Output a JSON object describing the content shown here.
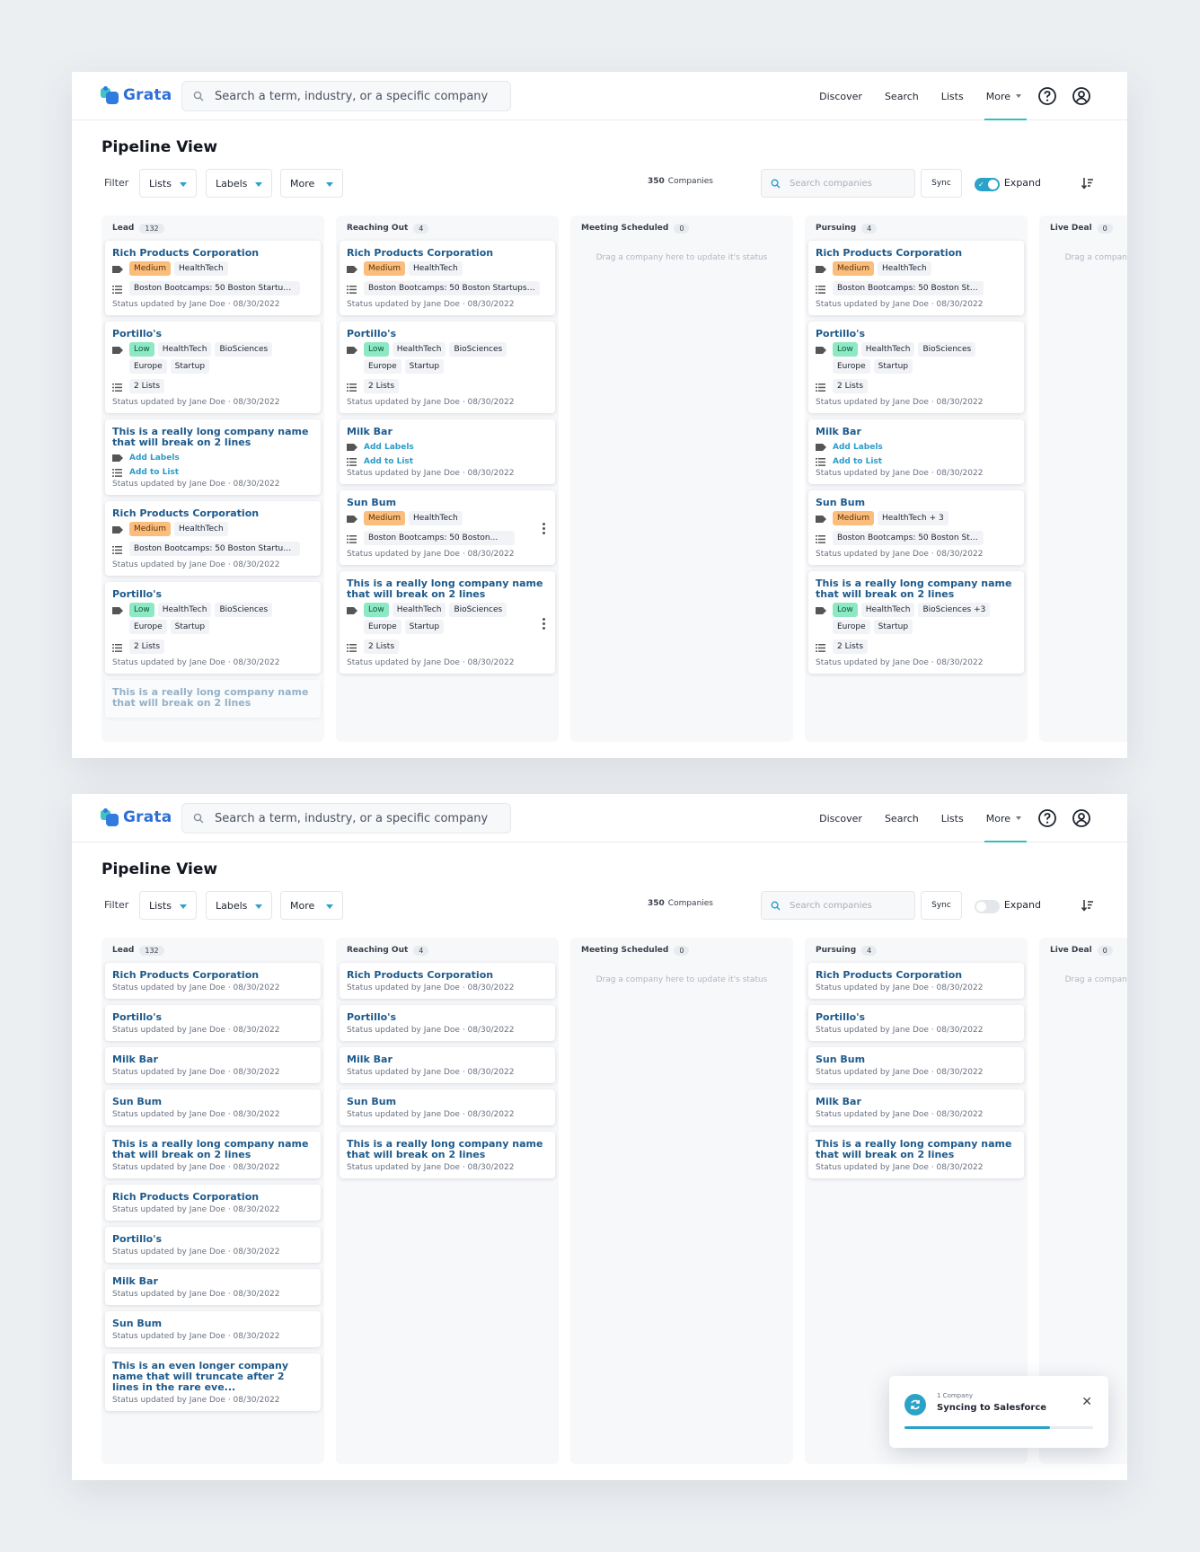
{
  "brand": {
    "name": "Grata"
  },
  "search": {
    "placeholder": "Search a term, industry, or a specific company"
  },
  "nav": {
    "discover": "Discover",
    "search": "Search",
    "lists": "Lists",
    "more": "More"
  },
  "page": {
    "title": "Pipeline View"
  },
  "filters": {
    "label": "Filter",
    "lists": "Lists",
    "labels": "Labels",
    "more": "More"
  },
  "companies": {
    "count": "350",
    "label": "Companies"
  },
  "company_search": {
    "placeholder": "Search companies"
  },
  "sync": {
    "label": "Sync"
  },
  "expand": {
    "label": "Expand",
    "expanded_view": true,
    "compact_view": false
  },
  "empty_text": "Drag a company here to update it's status",
  "columns": [
    {
      "name": "Lead",
      "count": "132"
    },
    {
      "name": "Reaching Out",
      "count": "4"
    },
    {
      "name": "Meeting Scheduled",
      "count": "0"
    },
    {
      "name": "Pursuing",
      "count": "4"
    },
    {
      "name": "Live Deal",
      "count": "0"
    }
  ],
  "expanded_cards": {
    "lead": [
      {
        "name": "Rich Products Corporation",
        "labels": [
          "Medium",
          "HealthTech"
        ],
        "list": "Boston Bootcamps: 50 Boston Startups t...",
        "status": "Status updated by Jane Doe · 08/30/2022"
      },
      {
        "name": "Portillo's",
        "labels": [
          "Low",
          "HealthTech",
          "BioSciences",
          "Europe",
          "Startup"
        ],
        "list": "2 Lists",
        "status": "Status updated by Jane Doe · 08/30/2022"
      },
      {
        "name": "This is a really long company name that will break on 2 lines",
        "add_labels": "Add Labels",
        "add_list": "Add to List",
        "status": "Status updated by Jane Doe · 08/30/2022"
      },
      {
        "name": "Rich Products Corporation",
        "labels": [
          "Medium",
          "HealthTech"
        ],
        "list": "Boston Bootcamps: 50 Boston Startups t...",
        "status": "Status updated by Jane Doe · 08/30/2022"
      },
      {
        "name": "Portillo's",
        "labels": [
          "Low",
          "HealthTech",
          "BioSciences",
          "Europe",
          "Startup"
        ],
        "list": "2 Lists",
        "status": "Status updated by Jane Doe · 08/30/2022"
      },
      {
        "name": "This is a really long company name that will break on 2 lines"
      }
    ],
    "reaching_out": [
      {
        "name": "Rich Products Corporation",
        "labels": [
          "Medium",
          "HealthTech"
        ],
        "list": "Boston Bootcamps: 50 Boston Startups t...",
        "status": "Status updated by Jane Doe · 08/30/2022"
      },
      {
        "name": "Portillo's",
        "labels": [
          "Low",
          "HealthTech",
          "BioSciences",
          "Europe",
          "Startup"
        ],
        "list": "2 Lists",
        "status": "Status updated by Jane Doe · 08/30/2022"
      },
      {
        "name": "Milk Bar",
        "add_labels": "Add Labels",
        "add_list": "Add to List",
        "status": "Status updated by Jane Doe · 08/30/2022"
      },
      {
        "name": "Sun Bum",
        "labels": [
          "Medium",
          "HealthTech"
        ],
        "list": "Boston Bootcamps: 50 Boston...",
        "status": "Status updated by Jane Doe · 08/30/2022"
      },
      {
        "name": "This is a really long company name that will break on 2 lines",
        "labels": [
          "Low",
          "HealthTech",
          "BioSciences",
          "Europe",
          "Startup"
        ],
        "list": "2 Lists",
        "status": "Status updated by Jane Doe · 08/30/2022"
      }
    ],
    "pursuing": [
      {
        "name": "Rich Products Corporation",
        "labels": [
          "Medium",
          "HealthTech"
        ],
        "list": "Boston Bootcamps: 50 Boston Star....",
        "status": "Status updated by Jane Doe · 08/30/2022"
      },
      {
        "name": "Portillo's",
        "labels": [
          "Low",
          "HealthTech",
          "BioSciences",
          "Europe",
          "Startup"
        ],
        "list": "2 Lists",
        "status": "Status updated by Jane Doe · 08/30/2022"
      },
      {
        "name": "Milk Bar",
        "add_labels": "Add Labels",
        "add_list": "Add to List",
        "status": "Status updated by Jane Doe · 08/30/2022"
      },
      {
        "name": "Sun Bum",
        "labels": [
          "Medium",
          "HealthTech + 3"
        ],
        "list": "Boston Bootcamps: 50 Boston Star....",
        "status": "Status updated by Jane Doe · 08/30/2022"
      },
      {
        "name": "This is a really long company name that will break on 2 lines",
        "labels": [
          "Low",
          "HealthTech",
          "BioSciences +3",
          "Europe",
          "Startup"
        ],
        "list": "2 Lists",
        "status": "Status updated by Jane Doe · 08/30/2022"
      }
    ]
  },
  "compact_cards": {
    "lead": [
      {
        "name": "Rich Products Corporation",
        "status": "Status updated by Jane Doe · 08/30/2022"
      },
      {
        "name": "Portillo's",
        "status": "Status updated by Jane Doe · 08/30/2022"
      },
      {
        "name": "Milk Bar",
        "status": "Status updated by Jane Doe · 08/30/2022"
      },
      {
        "name": "Sun Bum",
        "status": "Status updated by Jane Doe · 08/30/2022"
      },
      {
        "name": "This is a really long company name that will break on 2 lines",
        "status": "Status updated by Jane Doe · 08/30/2022"
      },
      {
        "name": "Rich Products Corporation",
        "status": "Status updated by Jane Doe · 08/30/2022"
      },
      {
        "name": "Portillo's",
        "status": "Status updated by Jane Doe · 08/30/2022"
      },
      {
        "name": "Milk Bar",
        "status": "Status updated by Jane Doe · 08/30/2022"
      },
      {
        "name": "Sun Bum",
        "status": "Status updated by Jane Doe · 08/30/2022"
      },
      {
        "name": "This is an even longer company name that will truncate after 2 lines in the rare eve...",
        "status": "Status updated by Jane Doe · 08/30/2022"
      }
    ],
    "reaching_out": [
      {
        "name": "Rich Products Corporation",
        "status": "Status updated by Jane Doe · 08/30/2022"
      },
      {
        "name": "Portillo's",
        "status": "Status updated by Jane Doe · 08/30/2022"
      },
      {
        "name": "Milk Bar",
        "status": "Status updated by Jane Doe · 08/30/2022"
      },
      {
        "name": "Sun Bum",
        "status": "Status updated by Jane Doe · 08/30/2022"
      },
      {
        "name": "This is a really long company name that will break on 2 lines",
        "status": "Status updated by Jane Doe · 08/30/2022"
      }
    ],
    "pursuing": [
      {
        "name": "Rich Products Corporation",
        "status": "Status updated by Jane Doe · 08/30/2022"
      },
      {
        "name": "Portillo's",
        "status": "Status updated by Jane Doe · 08/30/2022"
      },
      {
        "name": "Sun Bum",
        "status": "Status updated by Jane Doe · 08/30/2022"
      },
      {
        "name": "Milk Bar",
        "status": "Status updated by Jane Doe · 08/30/2022"
      },
      {
        "name": "This is a really long company name that will break on 2 lines",
        "status": "Status updated by Jane Doe · 08/30/2022"
      }
    ]
  },
  "toast": {
    "subtitle": "1 Company",
    "title": "Syncing to Salesforce",
    "progress": 0.77
  },
  "colors": {
    "accent": "#2ba3c9",
    "brand": "#2d6fd6",
    "medium_label": "#fbbd7c",
    "low_label": "#8de8c4",
    "company_name": "#1d5a8c"
  }
}
